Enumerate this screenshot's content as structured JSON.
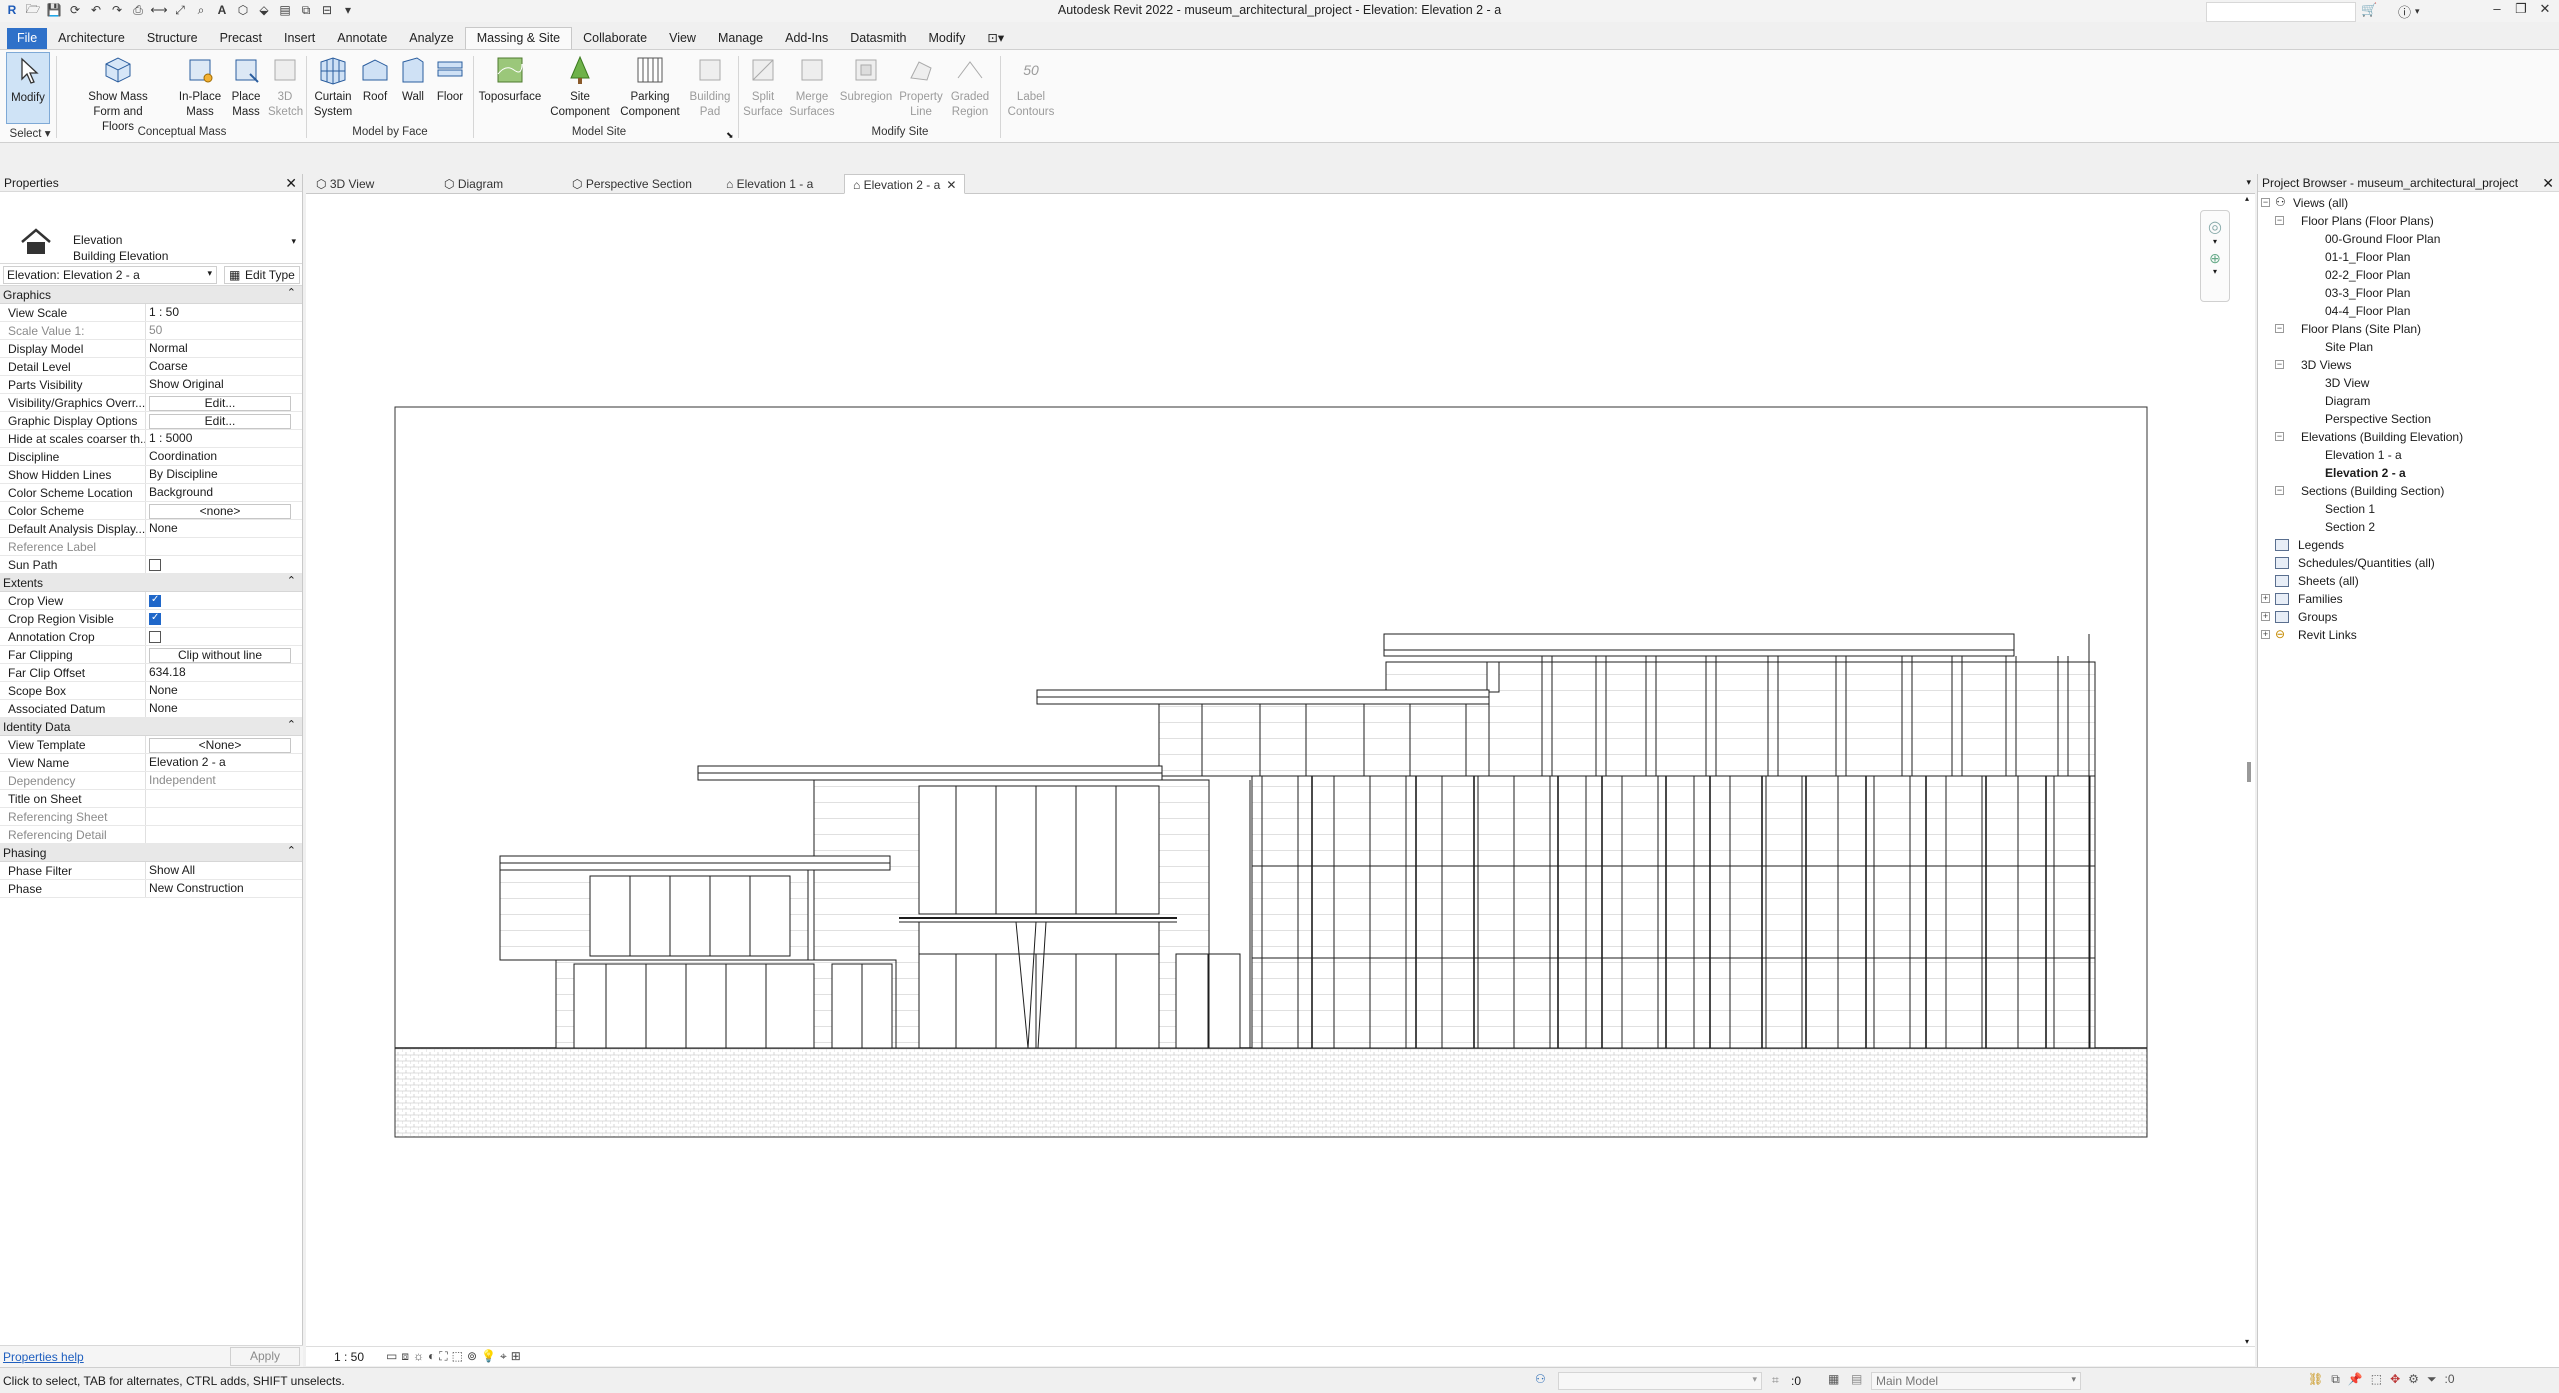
{
  "window": {
    "title": "Autodesk Revit 2022 - museum_architectural_project - Elevation: Elevation 2 - a"
  },
  "ribbon_tabs": [
    "File",
    "Architecture",
    "Structure",
    "Precast",
    "Insert",
    "Annotate",
    "Analyze",
    "Massing & Site",
    "Collaborate",
    "View",
    "Manage",
    "Add-Ins",
    "Datasmith",
    "Modify"
  ],
  "ribbon": {
    "modify": "Modify",
    "select": "Select",
    "show_mass": "Show Mass",
    "show_mass_2": "Form and Floors",
    "in_place_mass": "In-Place",
    "in_place_mass_2": "Mass",
    "place_mass": "Place",
    "place_mass_2": "Mass",
    "sketch_3d": "3D",
    "sketch_3d_2": "Sketch",
    "curtain_system": "Curtain",
    "curtain_system_2": "System",
    "roof": "Roof",
    "wall": "Wall",
    "floor": "Floor",
    "toposurface": "Toposurface",
    "site_component": "Site",
    "site_component_2": "Component",
    "parking_component": "Parking",
    "parking_component_2": "Component",
    "building_pad": "Building",
    "building_pad_2": "Pad",
    "split_surface": "Split",
    "split_surface_2": "Surface",
    "merge_surfaces": "Merge",
    "merge_surfaces_2": "Surfaces",
    "subregion": "Subregion",
    "property_line": "Property",
    "property_line_2": "Line",
    "graded_region": "Graded",
    "graded_region_2": "Region",
    "label_contours": "Label",
    "label_contours_2": "Contours",
    "label_contours_num": "50",
    "panels": [
      "Conceptual Mass",
      "Model by Face",
      "Model Site",
      "Modify Site"
    ]
  },
  "properties": {
    "title": "Properties",
    "type_line1": "Elevation",
    "type_line2": "Building Elevation",
    "instance": "Elevation: Elevation 2 - a",
    "edit_type": "Edit Type",
    "groups": {
      "graphics": "Graphics",
      "extents": "Extents",
      "identity": "Identity Data",
      "phasing": "Phasing"
    },
    "graphics_rows": [
      {
        "k": "View Scale",
        "v": "1 : 50"
      },
      {
        "k": "Scale Value    1:",
        "v": "50"
      },
      {
        "k": "Display Model",
        "v": "Normal"
      },
      {
        "k": "Detail Level",
        "v": "Coarse"
      },
      {
        "k": "Parts Visibility",
        "v": "Show Original"
      },
      {
        "k": "Visibility/Graphics Overr...",
        "v": "Edit..."
      },
      {
        "k": "Graphic Display Options",
        "v": "Edit..."
      },
      {
        "k": "Hide at scales coarser th...",
        "v": "1 : 5000"
      },
      {
        "k": "Discipline",
        "v": "Coordination"
      },
      {
        "k": "Show Hidden Lines",
        "v": "By Discipline"
      },
      {
        "k": "Color Scheme Location",
        "v": "Background"
      },
      {
        "k": "Color Scheme",
        "v": "<none>"
      },
      {
        "k": "Default Analysis Display...",
        "v": "None"
      },
      {
        "k": "Reference Label",
        "v": ""
      },
      {
        "k": "Sun Path",
        "v": ""
      }
    ],
    "extents_rows": [
      {
        "k": "Crop View",
        "v": ""
      },
      {
        "k": "Crop Region Visible",
        "v": ""
      },
      {
        "k": "Annotation Crop",
        "v": ""
      },
      {
        "k": "Far Clipping",
        "v": "Clip without line"
      },
      {
        "k": "Far Clip Offset",
        "v": "634.18"
      },
      {
        "k": "Scope Box",
        "v": "None"
      },
      {
        "k": "Associated Datum",
        "v": "None"
      }
    ],
    "identity_rows": [
      {
        "k": "View Template",
        "v": "<None>"
      },
      {
        "k": "View Name",
        "v": "Elevation 2 - a"
      },
      {
        "k": "Dependency",
        "v": "Independent"
      },
      {
        "k": "Title on Sheet",
        "v": ""
      },
      {
        "k": "Referencing Sheet",
        "v": ""
      },
      {
        "k": "Referencing Detail",
        "v": ""
      }
    ],
    "phasing_rows": [
      {
        "k": "Phase Filter",
        "v": "Show All"
      },
      {
        "k": "Phase",
        "v": "New Construction"
      }
    ],
    "help": "Properties help",
    "apply": "Apply"
  },
  "view_tabs": [
    "3D View",
    "Diagram",
    "Perspective Section",
    "Elevation 1 - a",
    "Elevation 2 - a"
  ],
  "view_scale": "1 : 50",
  "browser": {
    "title": "Project Browser - museum_architectural_project",
    "views_all": "Views (all)",
    "floor_plans": "Floor Plans (Floor Plans)",
    "floor_plan_items": [
      "00-Ground Floor Plan",
      "01-1_Floor Plan",
      "02-2_Floor Plan",
      "03-3_Floor Plan",
      "04-4_Floor Plan"
    ],
    "site_plans": "Floor Plans (Site Plan)",
    "site_plan_items": [
      "Site Plan"
    ],
    "views_3d": "3D Views",
    "views_3d_items": [
      "3D View",
      "Diagram",
      "Perspective Section"
    ],
    "elevations": "Elevations (Building Elevation)",
    "elevation_items": [
      "Elevation 1 - a",
      "Elevation 2 - a"
    ],
    "sections": "Sections (Building Section)",
    "section_items": [
      "Section 1",
      "Section 2"
    ],
    "legends": "Legends",
    "schedules": "Schedules/Quantities (all)",
    "sheets": "Sheets (all)",
    "families": "Families",
    "groups": "Groups",
    "links": "Revit Links"
  },
  "status": {
    "hint": "Click to select, TAB for alternates, CTRL adds, SHIFT unselects.",
    "zero": ":0",
    "model": "Main Model"
  }
}
